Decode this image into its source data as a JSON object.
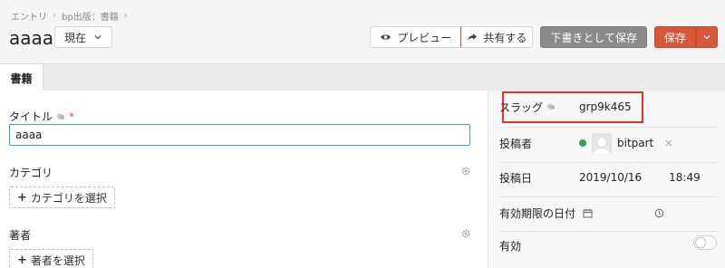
{
  "breadcrumb": {
    "items": [
      "エントリ",
      "bp出版：書籍"
    ]
  },
  "header": {
    "title": "aaaa",
    "status_select": "現在",
    "preview_label": "プレビュー",
    "share_label": "共有する",
    "draft_label": "下書きとして保存",
    "save_label": "保存"
  },
  "tabs": [
    {
      "label": "書籍"
    }
  ],
  "form": {
    "title_label": "タイトル",
    "required_mark": "*",
    "title_value": "aaaa",
    "category_label": "カテゴリ",
    "category_button": "カテゴリを選択",
    "author_label": "著者",
    "author_button": "著者を選択"
  },
  "side": {
    "slug_label": "スラッグ",
    "slug_value": "grp9k465",
    "author_label": "投稿者",
    "author_name": "bitpart",
    "date_label": "投稿日",
    "date_value": "2019/10/16",
    "time_value": "18:49",
    "expiry_label": "有効期限の日付",
    "enabled_label": "有効"
  },
  "colors": {
    "accent": "#d6583a",
    "highlight": "#e4352a",
    "focus": "#3b9bd8",
    "status_ok": "#2ea655"
  }
}
